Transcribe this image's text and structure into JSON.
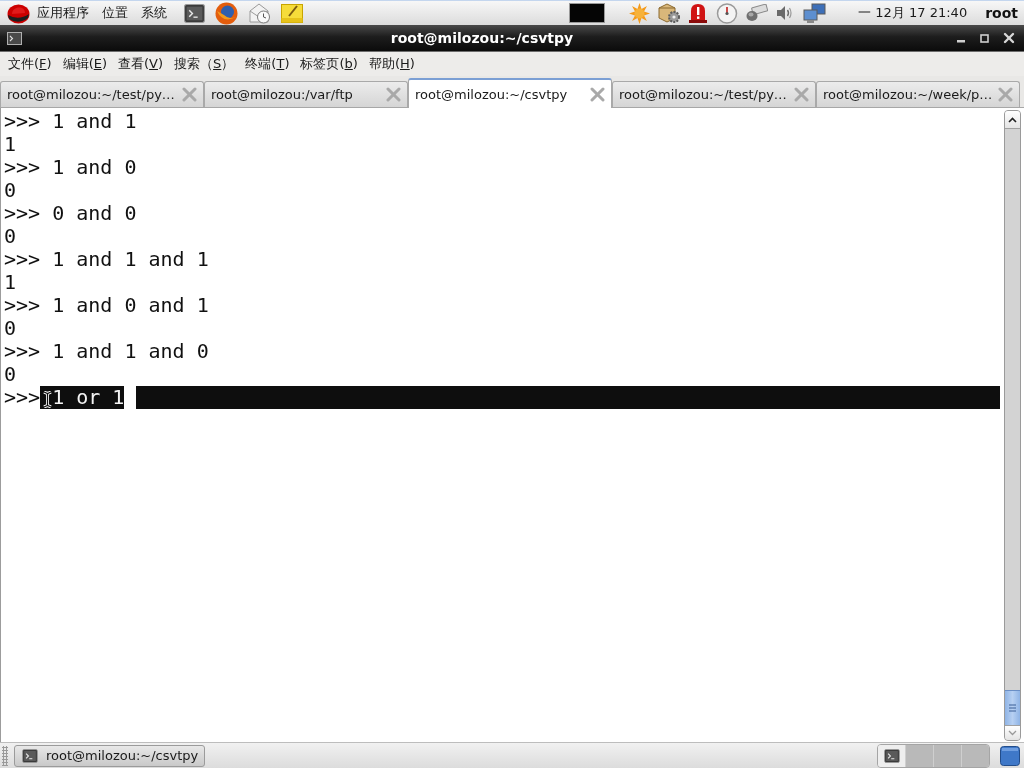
{
  "top_panel": {
    "menus": [
      "应用程序",
      "位置",
      "系统"
    ],
    "clock": "一 12月 17 21:40",
    "user": "root"
  },
  "window": {
    "title": "root@milozou:~/csvtpy"
  },
  "menu_bar": [
    {
      "label": "文件(",
      "mnemonic": "F",
      "suffix": ")"
    },
    {
      "label": "编辑(",
      "mnemonic": "E",
      "suffix": ")"
    },
    {
      "label": "查看(",
      "mnemonic": "V",
      "suffix": ")"
    },
    {
      "label": "搜索（",
      "mnemonic": "S",
      "suffix": "）"
    },
    {
      "label": "终端(",
      "mnemonic": "T",
      "suffix": ")"
    },
    {
      "label": "标签页(",
      "mnemonic": "b",
      "suffix": ")"
    },
    {
      "label": "帮助(",
      "mnemonic": "H",
      "suffix": ")"
    }
  ],
  "tabs": [
    {
      "label": "root@milozou:~/test/py…",
      "selected": false
    },
    {
      "label": "root@milozou:/var/ftp",
      "selected": false
    },
    {
      "label": "root@milozou:~/csvtpy",
      "selected": true
    },
    {
      "label": "root@milozou:~/test/py…",
      "selected": false
    },
    {
      "label": "root@milozou:~/week/p…",
      "selected": false
    }
  ],
  "terminal": {
    "lines": [
      ">>> 1 and 1",
      "1",
      ">>> 1 and 0",
      "0",
      ">>> 0 and 0",
      "0",
      ">>> 1 and 1 and 1",
      "1",
      ">>> 1 and 0 and 1",
      "0",
      ">>> 1 and 1 and 0",
      "0"
    ],
    "prompt": ">>>",
    "selected_input": "1 or 1"
  },
  "taskbar": {
    "windows": [
      {
        "label": "root@milozou:~/csvtpy"
      }
    ],
    "workspaces": [
      {
        "selected": true
      },
      {
        "selected": false
      },
      {
        "selected": false
      },
      {
        "selected": false
      }
    ]
  }
}
